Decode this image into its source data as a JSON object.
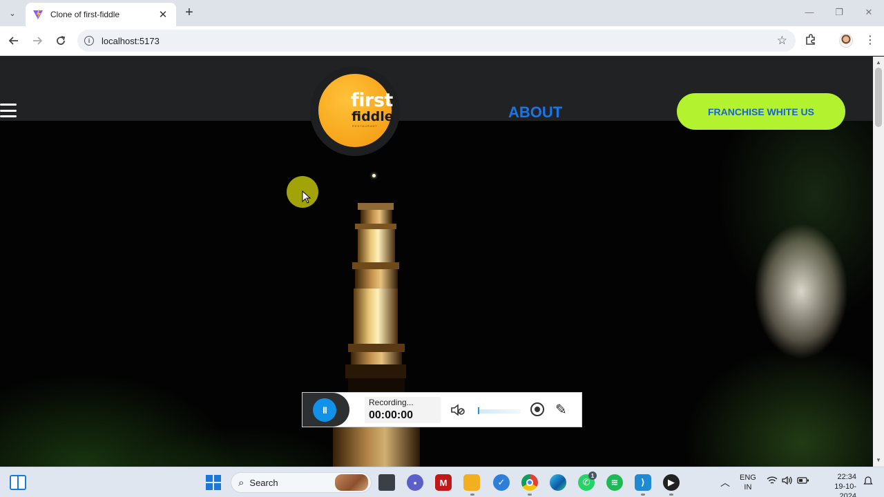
{
  "browser": {
    "tab_title": "Clone of first-fiddle",
    "tab_close": "✕",
    "new_tab": "+",
    "url": "localhost:5173",
    "window_controls": {
      "minimize": "—",
      "restore": "❐",
      "close": "✕"
    },
    "icons": [
      "back-icon",
      "forward-icon",
      "reload-icon",
      "site-info-icon",
      "bookmark-star-icon",
      "extensions-icon",
      "profile-avatar",
      "menu-dots-icon"
    ]
  },
  "page": {
    "logo": {
      "line1": "first",
      "line2": "fiddle",
      "tagline": "RESTAURANT"
    },
    "nav": {
      "about": "ABOUT"
    },
    "cta": {
      "franchise_label": "FRANCHISE WHITE US"
    },
    "colors": {
      "header_bg": "#212224",
      "logo_orange": "#f6a41a",
      "about_blue": "#1876e8",
      "cta_green": "#b3f22f",
      "cta_text": "#1565d8"
    }
  },
  "recorder": {
    "status": "Recording...",
    "time": "00:00:00",
    "pause_symbol": "II",
    "icons": [
      "pause-icon",
      "mic-muted-icon",
      "webcam-icon",
      "pen-icon"
    ]
  },
  "taskbar": {
    "search_placeholder": "Search",
    "apps": [
      "widgets",
      "start",
      "search",
      "task-view",
      "teams-chat",
      "mcafee",
      "file-explorer",
      "todo",
      "chrome",
      "edge",
      "whatsapp",
      "spotify",
      "vscode",
      "media-player"
    ],
    "whatsapp_badge": "1",
    "language": {
      "line1": "ENG",
      "line2": "IN"
    },
    "clock": {
      "time": "22:34",
      "date": "19-10-2024"
    }
  }
}
